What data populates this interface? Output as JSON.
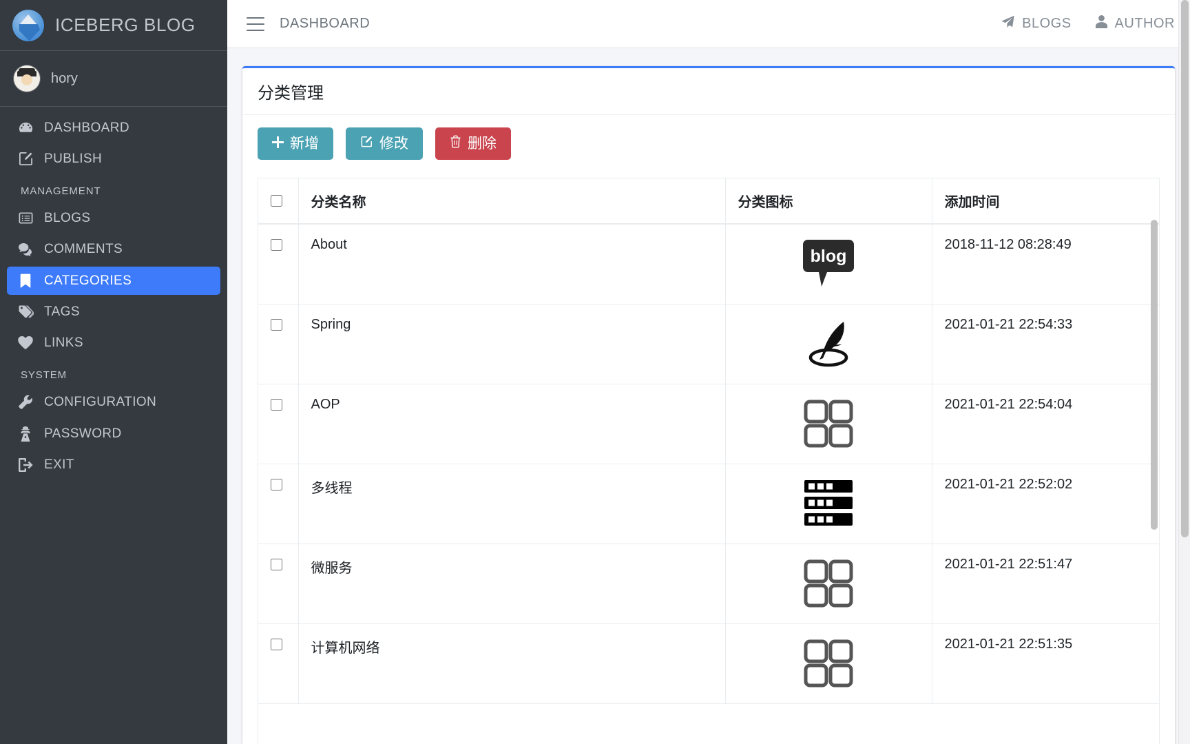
{
  "brand": {
    "title": "ICEBERG BLOG",
    "logo_icon": "iceberg-icon"
  },
  "user": {
    "name": "hory",
    "avatar_icon": "user-avatar-icon"
  },
  "sidebar": {
    "items": [
      {
        "label": "DASHBOARD",
        "icon": "tachometer-icon",
        "active": false
      },
      {
        "label": "PUBLISH",
        "icon": "edit-square-icon",
        "active": false
      }
    ],
    "sections": [
      {
        "header": "MANAGEMENT",
        "items": [
          {
            "label": "BLOGS",
            "icon": "list-alt-icon",
            "active": false
          },
          {
            "label": "COMMENTS",
            "icon": "comments-icon",
            "active": false
          },
          {
            "label": "CATEGORIES",
            "icon": "bookmark-icon",
            "active": true
          },
          {
            "label": "TAGS",
            "icon": "tags-icon",
            "active": false
          },
          {
            "label": "LINKS",
            "icon": "heart-icon",
            "active": false
          }
        ]
      },
      {
        "header": "SYSTEM",
        "items": [
          {
            "label": "CONFIGURATION",
            "icon": "wrench-icon",
            "active": false
          },
          {
            "label": "PASSWORD",
            "icon": "user-secret-icon",
            "active": false
          },
          {
            "label": "EXIT",
            "icon": "sign-out-icon",
            "active": false
          }
        ]
      }
    ]
  },
  "navbar": {
    "menu_toggle_icon": "hamburger-icon",
    "brand_link": "DASHBOARD",
    "right_links": [
      {
        "label": "BLOGS",
        "icon": "paper-plane-icon"
      },
      {
        "label": "AUTHOR",
        "icon": "user-icon"
      }
    ]
  },
  "page": {
    "card_title": "分类管理",
    "buttons": [
      {
        "label": "新增",
        "icon": "plus-icon",
        "style": "info"
      },
      {
        "label": "修改",
        "icon": "edit-icon",
        "style": "info"
      },
      {
        "label": "删除",
        "icon": "trash-icon",
        "style": "danger"
      }
    ],
    "table": {
      "select_all_checked": false,
      "columns": [
        "",
        "分类名称",
        "分类图标",
        "添加时间"
      ],
      "rows": [
        {
          "checked": false,
          "name": "About",
          "icon": "blog-bubble-icon",
          "time": "2018-11-12 08:28:49"
        },
        {
          "checked": false,
          "name": "Spring",
          "icon": "spring-leaf-icon",
          "time": "2021-01-21 22:54:33"
        },
        {
          "checked": false,
          "name": "AOP",
          "icon": "th-large-icon",
          "time": "2021-01-21 22:54:04"
        },
        {
          "checked": false,
          "name": "多线程",
          "icon": "server-icon",
          "time": "2021-01-21 22:52:02"
        },
        {
          "checked": false,
          "name": "微服务",
          "icon": "th-large-icon",
          "time": "2021-01-21 22:51:47"
        },
        {
          "checked": false,
          "name": "计算机网络",
          "icon": "th-large-icon",
          "time": "2021-01-21 22:51:35"
        }
      ]
    }
  },
  "colors": {
    "sidebar_bg": "#343a40",
    "accent": "#3d7bfb",
    "btn_info": "#4ba2b3",
    "btn_danger": "#c9444d",
    "page_bg": "#f4f6f9"
  }
}
